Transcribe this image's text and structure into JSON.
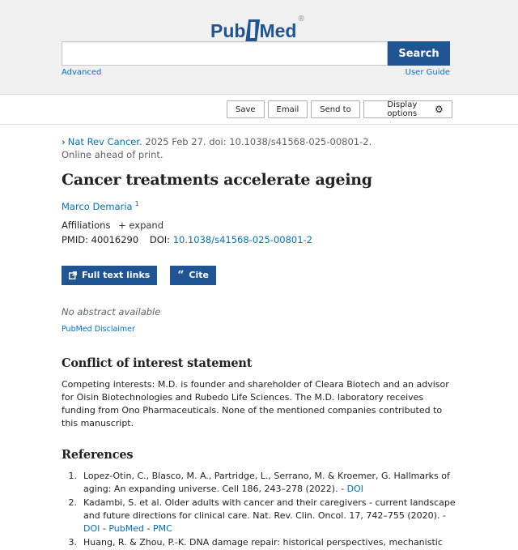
{
  "header": {
    "logo_pub": "Pub",
    "logo_med": "Med",
    "logo_reg": "®",
    "search_placeholder": "",
    "search_label": "Search",
    "advanced_label": "Advanced",
    "user_guide_label": "User Guide"
  },
  "actions": {
    "save": "Save",
    "email": "Email",
    "send_to": "Send to",
    "display_options": "Display options"
  },
  "article": {
    "journal": "Nat Rev Cancer.",
    "citation": " 2025 Feb 27. doi: 10.1038/s41568-025-00801-2.",
    "epub_note": "Online ahead of print.",
    "title": "Cancer treatments accelerate ageing",
    "author": "Marco Demaria",
    "author_sup": "1",
    "affiliations_label": "Affiliations",
    "expand_label": "+ expand",
    "pmid_label": "PMID:",
    "pmid": "40016290",
    "doi_label": "DOI:",
    "doi": "10.1038/s41568-025-00801-2",
    "full_text_label": "Full text links",
    "cite_label": "Cite",
    "no_abstract": "No abstract available",
    "disclaimer": "PubMed Disclaimer"
  },
  "coi": {
    "heading": "Conflict of interest statement",
    "text": "Competing interests: M.D. is founder and shareholder of Cleara Biotech and an advisor for Oisin Biotechnologies and Rubedo Life Sciences. The M.D. laboratory receives funding from Ono Pharmaceuticals. None of the mentioned companies contributed to this manuscript."
  },
  "references": {
    "heading": "References",
    "items": [
      {
        "num": "1.",
        "text": "Lopez-Otin, C., Blasco, M. A., Partridge, L., Serrano, M. & Kroemer, G. Hallmarks of aging: An expanding universe. Cell 186, 243–278 (2022). - ",
        "link1": "DOI",
        "sep": "",
        "link2": "",
        "sep2": "",
        "link3": ""
      },
      {
        "num": "2.",
        "text": "Kadambi, S. et al. Older adults with cancer and their caregivers - current landscape and future directions for clinical care. Nat. Rev. Clin. Oncol. 17, 742–755 (2020). - ",
        "link1": "DOI",
        "sep": " - ",
        "link2": "PubMed",
        "sep2": " - ",
        "link3": "PMC"
      },
      {
        "num": "3.",
        "text": "Huang, R. & Zhou, P.-K. DNA damage repair: historical perspectives, mechanistic",
        "link1": "",
        "sep": "",
        "link2": "",
        "sep2": "",
        "link3": ""
      }
    ]
  },
  "colors": {
    "brand": "#205493",
    "link": "#0071bc"
  }
}
